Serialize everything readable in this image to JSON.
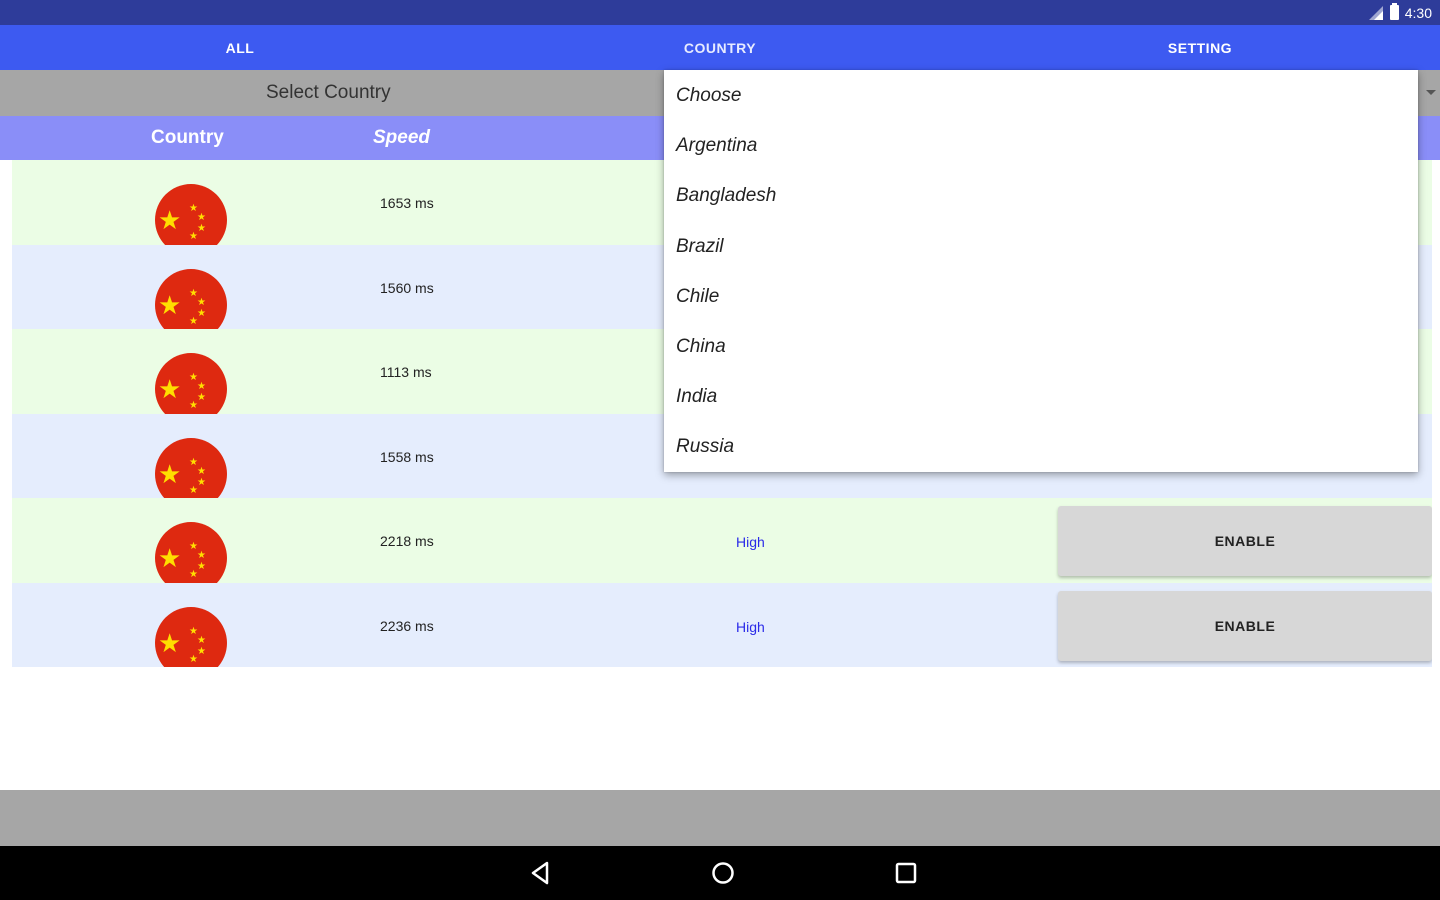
{
  "status": {
    "time": "4:30"
  },
  "tabs": [
    {
      "label": "ALL"
    },
    {
      "label": "COUNTRY"
    },
    {
      "label": "SETTING"
    }
  ],
  "select": {
    "label": "Select Country"
  },
  "table": {
    "headers": {
      "country": "Country",
      "speed": "Speed"
    },
    "rows": [
      {
        "speed": "1653  ms",
        "quality": "",
        "button": ""
      },
      {
        "speed": "1560 ms",
        "quality": "",
        "button": ""
      },
      {
        "speed": "1113 ms",
        "quality": "",
        "button": ""
      },
      {
        "speed": "1558 ms",
        "quality": "",
        "button": ""
      },
      {
        "speed": "2218   ms",
        "quality": "High",
        "button": "ENABLE"
      },
      {
        "speed": "2236 ms",
        "quality": "High",
        "button": "ENABLE"
      }
    ]
  },
  "dropdown": {
    "options": [
      "Choose",
      "Argentina",
      "Bangladesh",
      "Brazil",
      "Chile",
      "China",
      "India",
      "Russia"
    ]
  },
  "colors": {
    "tab_bar": "#3d5af1",
    "status_bar": "#2e3c9a",
    "header_row": "#8a8ef8",
    "row_green": "#ebfde5",
    "row_blue": "#e5edfd",
    "quality_text": "#2a2ae8"
  },
  "icons": [
    "signal-icon",
    "battery-icon",
    "china-flag-icon",
    "back-icon",
    "home-icon",
    "recents-icon",
    "dropdown-arrow-icon"
  ]
}
